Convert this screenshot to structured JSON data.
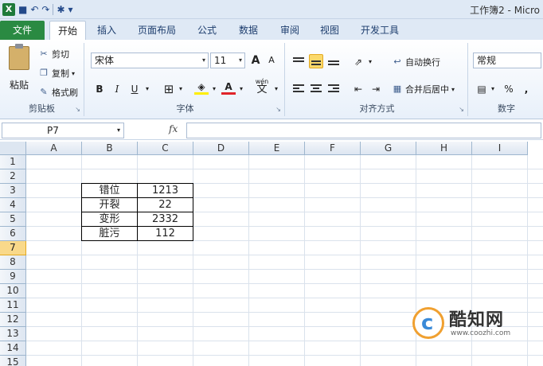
{
  "window": {
    "title": "工作簿2 - Micro"
  },
  "tabs": [
    {
      "label": "文件"
    },
    {
      "label": "开始"
    },
    {
      "label": "插入"
    },
    {
      "label": "页面布局"
    },
    {
      "label": "公式"
    },
    {
      "label": "数据"
    },
    {
      "label": "审阅"
    },
    {
      "label": "视图"
    },
    {
      "label": "开发工具"
    }
  ],
  "clipboard": {
    "paste": "粘贴",
    "cut": "剪切",
    "copy": "复制",
    "format_painter": "格式刷",
    "group": "剪贴板"
  },
  "font": {
    "name": "宋体",
    "size": "11",
    "bold": "B",
    "italic": "I",
    "underline": "U",
    "grow": "A",
    "shrink": "A",
    "group": "字体",
    "color_letter": "A",
    "phonetic": "wén"
  },
  "alignment": {
    "wrap": "自动换行",
    "merge": "合并后居中",
    "group": "对齐方式"
  },
  "number": {
    "format": "常规",
    "percent": "%",
    "comma": ",",
    "group": "数字"
  },
  "formula_bar": {
    "cell_ref": "P7",
    "fx": "fx",
    "value": ""
  },
  "columns": [
    "A",
    "B",
    "C",
    "D",
    "E",
    "F",
    "G",
    "H",
    "I"
  ],
  "rows": [
    "1",
    "2",
    "3",
    "4",
    "5",
    "6",
    "7",
    "8",
    "9",
    "10",
    "11",
    "12",
    "13",
    "14",
    "15"
  ],
  "selected_row": "7",
  "table": [
    {
      "label": "错位",
      "value": "1213"
    },
    {
      "label": "开裂",
      "value": "22"
    },
    {
      "label": "变形",
      "value": "2332"
    },
    {
      "label": "脏污",
      "value": "112"
    }
  ],
  "watermark": {
    "name": "酷知网",
    "url": "www.coozhi.com"
  },
  "colors": {
    "file_tab": "#2a8a42",
    "selection": "#f9d98a",
    "font_color": "#e0242a",
    "fill_color": "#ffee00"
  }
}
